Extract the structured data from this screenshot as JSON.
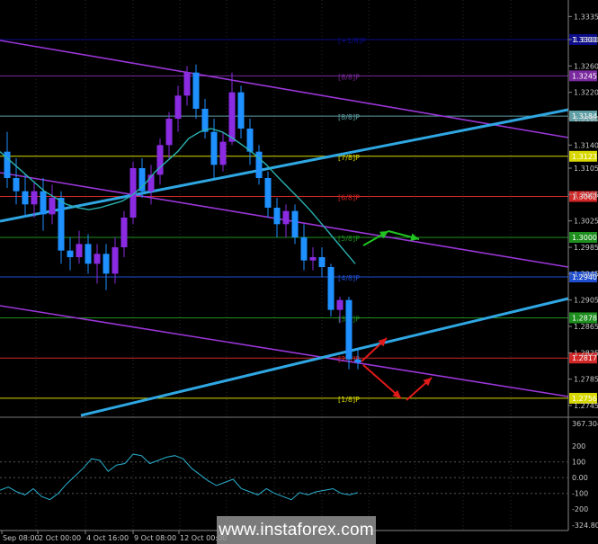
{
  "chart_data": [
    {
      "type": "line",
      "instrument": "GBP/USD",
      "price_axis_ticks": [
        "1.3335",
        "1.3300",
        "1.3260",
        "1.3220",
        "1.3180",
        "1.3140",
        "1.3105",
        "1.3065",
        "1.3025",
        "1.2985",
        "1.2945",
        "1.2905",
        "1.2865",
        "1.2825",
        "1.2785",
        "1.2745"
      ],
      "murrey_levels": [
        {
          "label": "[+1/8]P",
          "price": "1.3300",
          "color": "#0c0c8a"
        },
        {
          "label": "[8/8]P",
          "price": "1.3245",
          "color": "#7a2a9e"
        },
        {
          "label": "[8/8]P",
          "price": "1.3184",
          "color": "#5fa0a6"
        },
        {
          "label": "[7/8]P",
          "price": "1.3123",
          "color": "#d8d800"
        },
        {
          "label": "[6/8]P",
          "price": "1.3062",
          "color": "#d22727"
        },
        {
          "label": "[5/8]P",
          "price": "1.3000",
          "color": "#1e8f1e"
        },
        {
          "label": "[4/8]P",
          "price": "1.2940",
          "color": "#1f4fcf"
        },
        {
          "label": "[3/8]P",
          "price": "1.2878",
          "color": "#1e8f1e"
        },
        {
          "label": "[2/8]P",
          "price": "1.2817",
          "color": "#d22727"
        },
        {
          "label": "[1/8]P",
          "price": "1.2756",
          "color": "#d8d800"
        }
      ],
      "time_labels": [
        "Sep 08:00",
        "2 Oct 00:00",
        "4 Oct 16:00",
        "9 Oct 08:00",
        "12 Oct 00:00"
      ],
      "ma_series_price": [
        1.313,
        1.3115,
        1.31,
        1.3085,
        1.307,
        1.306,
        1.305,
        1.3045,
        1.3042,
        1.3045,
        1.305,
        1.3055,
        1.3065,
        1.308,
        1.31,
        1.3115,
        1.313,
        1.315,
        1.316,
        1.3165,
        1.316,
        1.315,
        1.3138,
        1.3125,
        1.311,
        1.3092,
        1.3075,
        1.3058,
        1.304,
        1.302,
        1.3,
        1.298,
        1.296
      ],
      "candles_ohlc": [
        [
          1.313,
          1.316,
          1.3075,
          1.309
        ],
        [
          1.309,
          1.312,
          1.305,
          1.307
        ],
        [
          1.307,
          1.3095,
          1.303,
          1.305
        ],
        [
          1.305,
          1.3085,
          1.303,
          1.307
        ],
        [
          1.307,
          1.309,
          1.301,
          1.3035
        ],
        [
          1.3035,
          1.308,
          1.302,
          1.306
        ],
        [
          1.306,
          1.307,
          1.296,
          1.298
        ],
        [
          1.298,
          1.3,
          1.295,
          1.297
        ],
        [
          1.297,
          1.301,
          1.296,
          1.299
        ],
        [
          1.299,
          1.3005,
          1.2945,
          1.296
        ],
        [
          1.296,
          1.299,
          1.293,
          1.2975
        ],
        [
          1.2975,
          1.299,
          1.292,
          1.2945
        ],
        [
          1.2945,
          1.3,
          1.293,
          1.2985
        ],
        [
          1.2985,
          1.304,
          1.297,
          1.303
        ],
        [
          1.303,
          1.3115,
          1.302,
          1.3105
        ],
        [
          1.3105,
          1.312,
          1.306,
          1.307
        ],
        [
          1.307,
          1.311,
          1.305,
          1.3095
        ],
        [
          1.3095,
          1.315,
          1.308,
          1.314
        ],
        [
          1.314,
          1.319,
          1.312,
          1.318
        ],
        [
          1.318,
          1.323,
          1.316,
          1.3215
        ],
        [
          1.3215,
          1.326,
          1.32,
          1.325
        ],
        [
          1.325,
          1.3262,
          1.318,
          1.3195
        ],
        [
          1.3195,
          1.321,
          1.315,
          1.316
        ],
        [
          1.316,
          1.318,
          1.309,
          1.311
        ],
        [
          1.311,
          1.316,
          1.31,
          1.3145
        ],
        [
          1.3145,
          1.325,
          1.314,
          1.322
        ],
        [
          1.322,
          1.323,
          1.315,
          1.3165
        ],
        [
          1.3165,
          1.318,
          1.311,
          1.313
        ],
        [
          1.313,
          1.314,
          1.308,
          1.309
        ],
        [
          1.309,
          1.31,
          1.303,
          1.3045
        ],
        [
          1.3045,
          1.306,
          1.3,
          1.302
        ],
        [
          1.302,
          1.305,
          1.3,
          1.304
        ],
        [
          1.304,
          1.305,
          1.299,
          1.3
        ],
        [
          1.3,
          1.302,
          1.295,
          1.2965
        ],
        [
          1.2965,
          1.2985,
          1.295,
          1.297
        ],
        [
          1.297,
          1.2985,
          1.294,
          1.2955
        ],
        [
          1.2955,
          1.296,
          1.288,
          1.289
        ],
        [
          1.289,
          1.291,
          1.287,
          1.2905
        ],
        [
          1.2905,
          1.291,
          1.28,
          1.2815
        ],
        [
          1.2815,
          1.283,
          1.28,
          1.281
        ]
      ],
      "oscillator": {
        "ticks": [
          "367.3047",
          "200",
          "100",
          "0.00",
          "-100",
          "-200",
          "-324.8088"
        ],
        "values": [
          -80,
          -60,
          -90,
          -110,
          -70,
          -120,
          -140,
          -100,
          -40,
          10,
          60,
          120,
          110,
          40,
          80,
          90,
          150,
          140,
          90,
          110,
          130,
          140,
          120,
          60,
          20,
          -20,
          -50,
          -30,
          -10,
          -70,
          -90,
          -110,
          -70,
          -100,
          -120,
          -140,
          -95,
          -110,
          -90,
          -80,
          -70,
          -100,
          -110,
          -95
        ]
      },
      "forecast_arrows": [
        {
          "name": "forecast-up-arrow-green-1",
          "color": "#21c421"
        },
        {
          "name": "forecast-up-arrow-green-2",
          "color": "#21c421"
        },
        {
          "name": "forecast-up-arrow-red",
          "color": "#e01a1a"
        },
        {
          "name": "forecast-down-arrow-red-1",
          "color": "#e01a1a"
        },
        {
          "name": "forecast-down-arrow-red-2",
          "color": "#e01a1a"
        }
      ],
      "colors": {
        "background": "#000000",
        "bull_candle": "#8a2be2",
        "bear_candle": "#1e90ff",
        "ma": "#2ab0b0",
        "trend_line": "#2fa7e3",
        "channel": "#9a36d8",
        "grid": "#2a2a2a",
        "axis_text": "#c8c8c8"
      }
    }
  ],
  "watermark": "www.instaforex.com"
}
